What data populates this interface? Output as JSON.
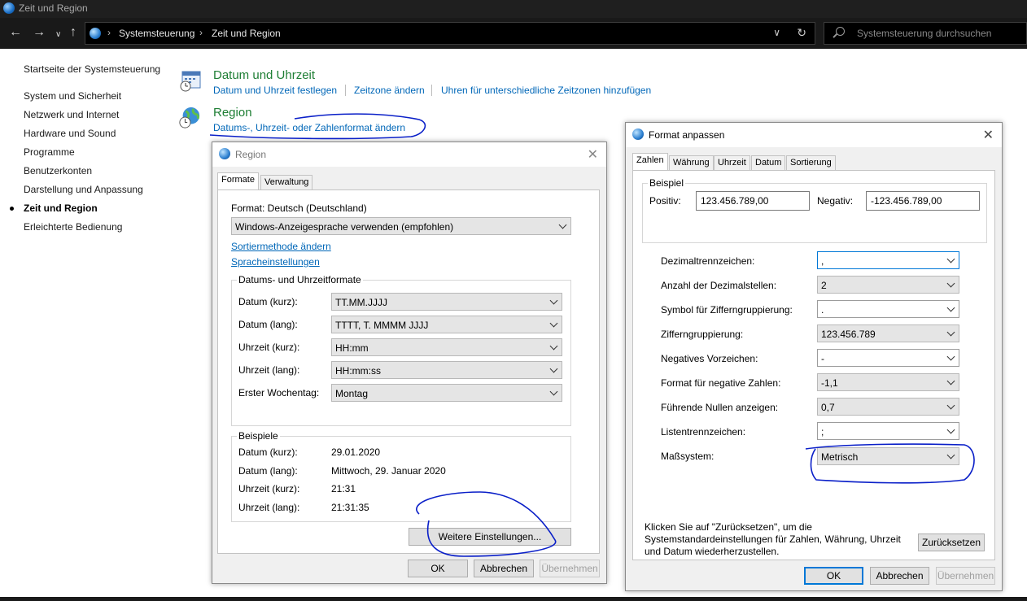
{
  "window": {
    "title": "Zeit und Region"
  },
  "address": {
    "crumbs": [
      "Systemsteuerung",
      "Zeit und Region"
    ],
    "search_placeholder": "Systemsteuerung durchsuchen"
  },
  "sidebar": {
    "home": "Startseite der Systemsteuerung",
    "items": [
      "System und Sicherheit",
      "Netzwerk und Internet",
      "Hardware und Sound",
      "Programme",
      "Benutzerkonten",
      "Darstellung und Anpassung",
      "Zeit und Region",
      "Erleichterte Bedienung"
    ],
    "current": "Zeit und Region"
  },
  "categories": {
    "datetime": {
      "title": "Datum und Uhrzeit",
      "links": [
        "Datum und Uhrzeit festlegen",
        "Zeitzone ändern",
        "Uhren für unterschiedliche Zeitzonen hinzufügen"
      ]
    },
    "region": {
      "title": "Region",
      "links": [
        "Datums-, Uhrzeit- oder Zahlenformat ändern"
      ]
    }
  },
  "region_dialog": {
    "title": "Region",
    "tabs": [
      "Formate",
      "Verwaltung"
    ],
    "format_label": "Format: Deutsch (Deutschland)",
    "format_value": "Windows-Anzeigesprache verwenden (empfohlen)",
    "links": [
      "Sortiermethode ändern",
      "Spracheinstellungen"
    ],
    "formats_group": "Datums- und Uhrzeitformate",
    "formats": [
      {
        "label": "Datum (kurz):",
        "value": "TT.MM.JJJJ"
      },
      {
        "label": "Datum (lang):",
        "value": "TTTT, T. MMMM JJJJ"
      },
      {
        "label": "Uhrzeit (kurz):",
        "value": "HH:mm"
      },
      {
        "label": "Uhrzeit (lang):",
        "value": "HH:mm:ss"
      },
      {
        "label": "Erster Wochentag:",
        "value": "Montag"
      }
    ],
    "examples_group": "Beispiele",
    "examples": [
      {
        "label": "Datum (kurz):",
        "value": "29.01.2020"
      },
      {
        "label": "Datum (lang):",
        "value": "Mittwoch, 29. Januar 2020"
      },
      {
        "label": "Uhrzeit (kurz):",
        "value": "21:31"
      },
      {
        "label": "Uhrzeit (lang):",
        "value": "21:31:35"
      }
    ],
    "more_button": "Weitere Einstellungen...",
    "ok": "OK",
    "cancel": "Abbrechen",
    "apply": "Übernehmen"
  },
  "format_dialog": {
    "title": "Format anpassen",
    "tabs": [
      "Zahlen",
      "Währung",
      "Uhrzeit",
      "Datum",
      "Sortierung"
    ],
    "example_group": "Beispiel",
    "positive_label": "Positiv:",
    "positive_value": "123.456.789,00",
    "negative_label": "Negativ:",
    "negative_value": "-123.456.789,00",
    "settings": [
      {
        "label": "Dezimaltrennzeichen:",
        "value": ","
      },
      {
        "label": "Anzahl der Dezimalstellen:",
        "value": "2"
      },
      {
        "label": "Symbol für Zifferngruppierung:",
        "value": "."
      },
      {
        "label": "Zifferngruppierung:",
        "value": "123.456.789"
      },
      {
        "label": "Negatives Vorzeichen:",
        "value": "-"
      },
      {
        "label": "Format für negative Zahlen:",
        "value": "-1,1"
      },
      {
        "label": "Führende Nullen anzeigen:",
        "value": "0,7"
      },
      {
        "label": "Listentrennzeichen:",
        "value": ";"
      },
      {
        "label": "Maßsystem:",
        "value": "Metrisch"
      }
    ],
    "reset_text": [
      "Klicken Sie auf \"Zurücksetzen\", um die",
      "Systemstandardeinstellungen für Zahlen, Währung, Uhrzeit",
      "und Datum wiederherzustellen."
    ],
    "reset_button": "Zurücksetzen",
    "ok": "OK",
    "cancel": "Abbrechen",
    "apply": "Übernehmen"
  },
  "colors": {
    "accent": "#0078d7",
    "link": "#0067b8",
    "category": "#1e7e34",
    "ink": "#0a1fc8"
  }
}
